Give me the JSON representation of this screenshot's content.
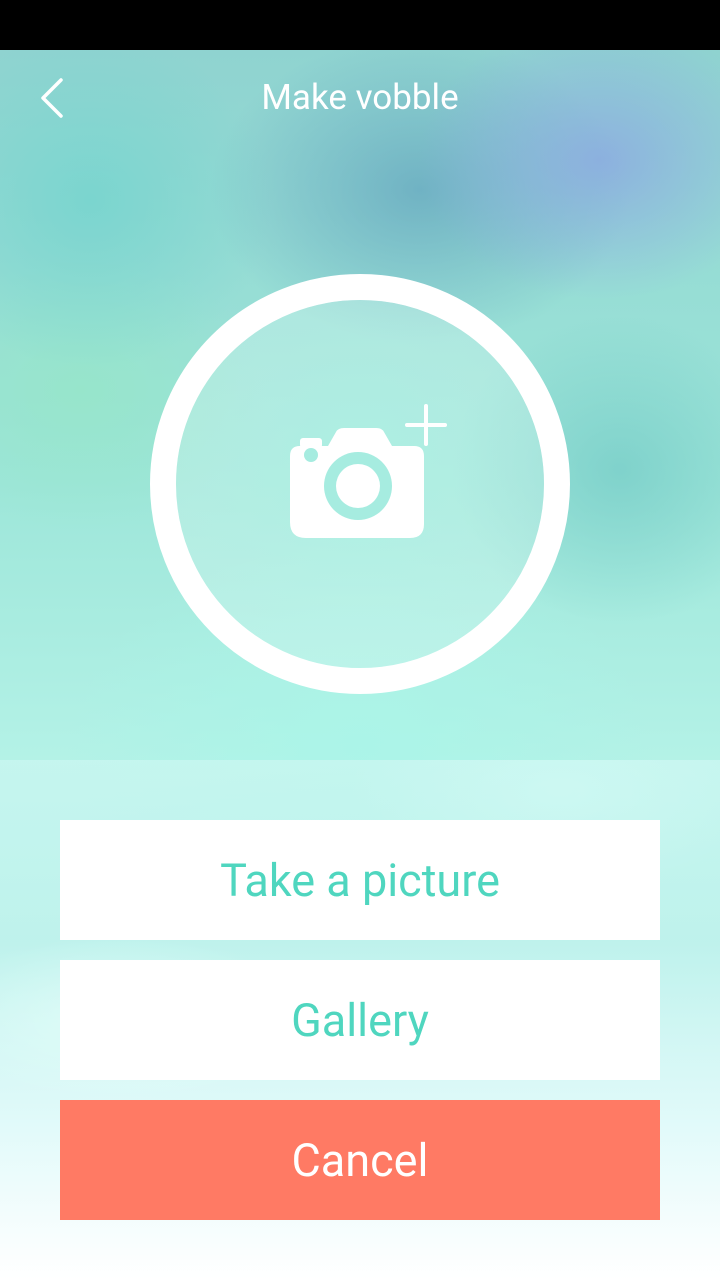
{
  "header": {
    "title": "Make vobble",
    "back_icon": "chevron-left-icon"
  },
  "photo_picker": {
    "icon": "camera-plus-icon",
    "ring_color": "#ffffff"
  },
  "actions": {
    "take_picture_label": "Take a picture",
    "gallery_label": "Gallery",
    "cancel_label": "Cancel"
  },
  "colors": {
    "accent": "#4fd6bf",
    "cancel": "#ff7a64",
    "status_bar": "#000000"
  }
}
